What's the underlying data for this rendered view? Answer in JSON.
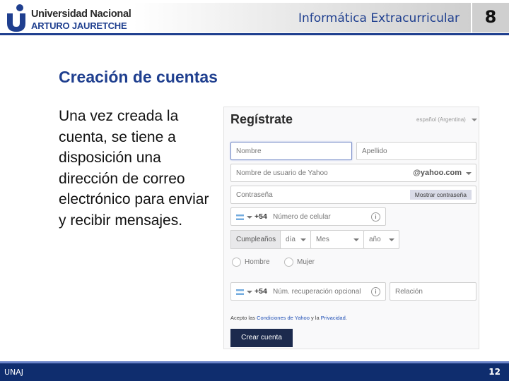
{
  "header": {
    "logo_line1": "Universidad Nacional",
    "logo_line2": "ARTURO JAURETCHE",
    "course_title": "Informática Extracurricular",
    "unit_number": "8"
  },
  "slide": {
    "title": "Creación de cuentas",
    "body": "Una vez creada la cuenta, se tiene a disposición una dirección de correo electrónico para enviar y recibir mensajes."
  },
  "form": {
    "title": "Regístrate",
    "language": "español (Argentina)",
    "first_name_placeholder": "Nombre",
    "last_name_placeholder": "Apellido",
    "username_placeholder": "Nombre de usuario de Yahoo",
    "domain_suffix": "@yahoo.com",
    "password_placeholder": "Contraseña",
    "show_password_label": "Mostrar contraseña",
    "country_code": "+54",
    "mobile_placeholder": "Número de celular",
    "birthday_label": "Cumpleaños",
    "day_placeholder": "día",
    "month_placeholder": "Mes",
    "year_placeholder": "año",
    "gender_male": "Hombre",
    "gender_female": "Mujer",
    "recovery_country_code": "+54",
    "recovery_placeholder": "Núm. recuperación opcional",
    "relation_placeholder": "Relación",
    "terms_prefix": "Acepto las ",
    "terms_link": "Condiciones de Yahoo",
    "terms_middle": " y la ",
    "privacy_link": "Privacidad",
    "terms_suffix": ".",
    "submit_label": "Crear cuenta"
  },
  "footer": {
    "left": "UNAJ",
    "page_number": "12"
  },
  "colors": {
    "brand_blue": "#1f3f8f",
    "footer_blue": "#0f2d6e",
    "submit_button": "#1c2a4d"
  }
}
